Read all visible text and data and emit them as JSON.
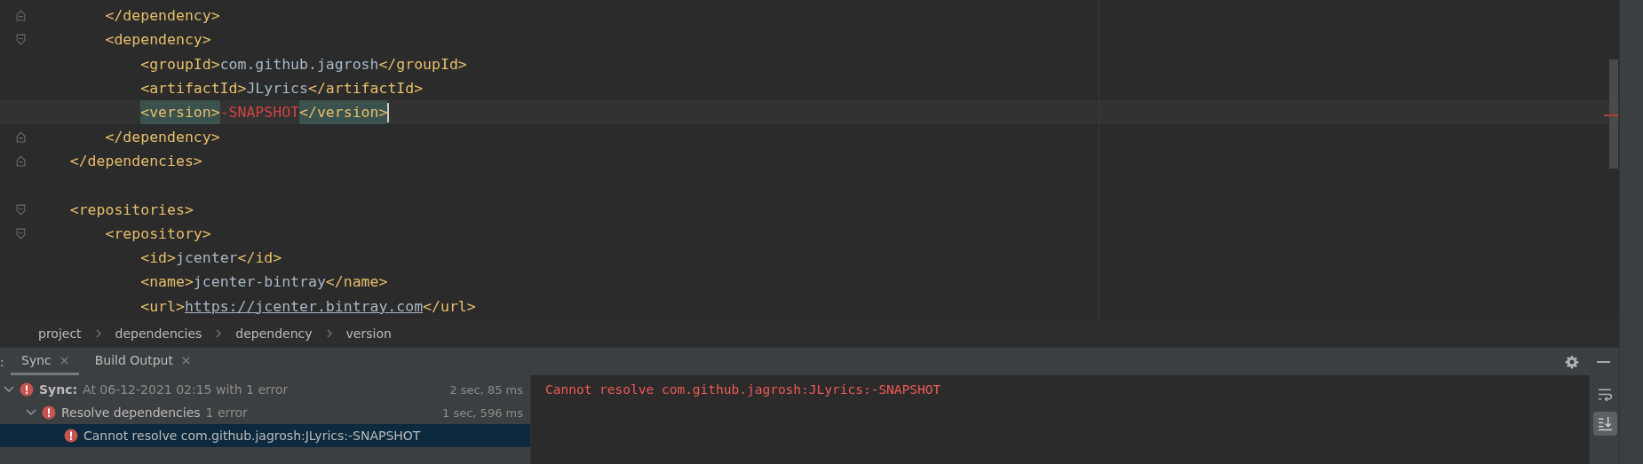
{
  "editor": {
    "lines": [
      {
        "fold_start": false,
        "fold_end": true,
        "current": false,
        "segments": [
          {
            "kind": "tag",
            "text": "        </dependency>"
          }
        ]
      },
      {
        "fold_start": true,
        "fold_end": false,
        "current": false,
        "segments": [
          {
            "kind": "tag",
            "text": "        <dependency>"
          }
        ]
      },
      {
        "fold_start": false,
        "fold_end": false,
        "current": false,
        "segments": [
          {
            "kind": "tag",
            "text": "            <groupId>"
          },
          {
            "kind": "text",
            "text": "com.github.jagrosh"
          },
          {
            "kind": "tag",
            "text": "</groupId>"
          }
        ]
      },
      {
        "fold_start": false,
        "fold_end": false,
        "current": false,
        "segments": [
          {
            "kind": "tag",
            "text": "            <artifactId>"
          },
          {
            "kind": "text",
            "text": "JLyrics"
          },
          {
            "kind": "tag",
            "text": "</artifactId>"
          }
        ]
      },
      {
        "fold_start": false,
        "fold_end": false,
        "current": true,
        "segments": [
          {
            "kind": "match",
            "text": "            <version>"
          },
          {
            "kind": "error",
            "text": "-SNAPSHOT"
          },
          {
            "kind": "match",
            "text": "</version>"
          }
        ]
      },
      {
        "fold_start": false,
        "fold_end": true,
        "current": false,
        "segments": [
          {
            "kind": "tag",
            "text": "        </dependency>"
          }
        ]
      },
      {
        "fold_start": false,
        "fold_end": true,
        "current": false,
        "segments": [
          {
            "kind": "tag",
            "text": "    </dependencies>"
          }
        ]
      },
      {
        "fold_start": false,
        "fold_end": false,
        "current": false
      },
      {
        "fold_start": true,
        "fold_end": false,
        "current": false,
        "segments": [
          {
            "kind": "tag",
            "text": "    <repositories>"
          }
        ]
      },
      {
        "fold_start": true,
        "fold_end": false,
        "current": false,
        "segments": [
          {
            "kind": "tag",
            "text": "        <repository>"
          }
        ]
      },
      {
        "fold_start": false,
        "fold_end": false,
        "current": false,
        "segments": [
          {
            "kind": "tag",
            "text": "            <id>"
          },
          {
            "kind": "text",
            "text": "jcenter"
          },
          {
            "kind": "tag",
            "text": "</id>"
          }
        ]
      },
      {
        "fold_start": false,
        "fold_end": false,
        "current": false,
        "segments": [
          {
            "kind": "tag",
            "text": "            <name>"
          },
          {
            "kind": "text",
            "text": "jcenter-bintray"
          },
          {
            "kind": "tag",
            "text": "</name>"
          }
        ]
      },
      {
        "fold_start": false,
        "fold_end": false,
        "current": false,
        "segments": [
          {
            "kind": "tag",
            "text": "            <url>"
          },
          {
            "kind": "link",
            "text": "https://jcenter.bintray.com"
          },
          {
            "kind": "tag",
            "text": "</url>"
          }
        ]
      }
    ]
  },
  "breadcrumbs": [
    "project",
    "dependencies",
    "dependency",
    "version"
  ],
  "tool_window": {
    "edge_text": ":",
    "tabs": [
      {
        "label": "Sync",
        "selected": true
      },
      {
        "label": "Build Output",
        "selected": false
      }
    ],
    "tree": [
      {
        "label": "Sync:",
        "detail": "At 06-12-2021 02:15 with 1 error",
        "time": "2 sec, 85 ms",
        "expanded": true,
        "selected": false,
        "children": [
          {
            "label": "Resolve dependencies",
            "detail": "1 error",
            "time": "1 sec, 596 ms",
            "expanded": true,
            "selected": false,
            "children": [
              {
                "label": "Cannot resolve com.github.jagrosh:JLyrics:-SNAPSHOT",
                "selected": true
              }
            ]
          }
        ]
      }
    ],
    "console": "Cannot resolve com.github.jagrosh:JLyrics:-SNAPSHOT",
    "console_tools": [
      {
        "kind": "wrap",
        "selected": false
      },
      {
        "kind": "scroll-end",
        "selected": true
      }
    ]
  }
}
